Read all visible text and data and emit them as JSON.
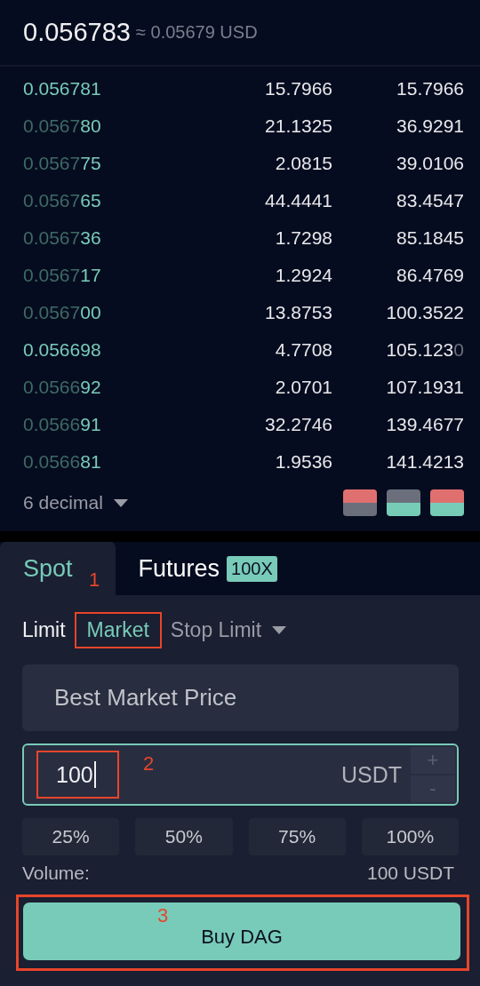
{
  "header": {
    "last_price": "0.056783",
    "approx": "≈ 0.05679 USD"
  },
  "order_book": {
    "rows": [
      {
        "price_dim": "",
        "price_hi": "0.056781",
        "amount": "15.7966",
        "total": "15.7966",
        "total_dim": ""
      },
      {
        "price_dim": "0.0567",
        "price_hi": "80",
        "amount": "21.1325",
        "total": "36.9291",
        "total_dim": ""
      },
      {
        "price_dim": "0.0567",
        "price_hi": "75",
        "amount": "2.0815",
        "total": "39.0106",
        "total_dim": ""
      },
      {
        "price_dim": "0.0567",
        "price_hi": "65",
        "amount": "44.4441",
        "total": "83.4547",
        "total_dim": ""
      },
      {
        "price_dim": "0.0567",
        "price_hi": "36",
        "amount": "1.7298",
        "total": "85.1845",
        "total_dim": ""
      },
      {
        "price_dim": "0.0567",
        "price_hi": "17",
        "amount": "1.2924",
        "total": "86.4769",
        "total_dim": ""
      },
      {
        "price_dim": "0.0567",
        "price_hi": "00",
        "amount": "13.8753",
        "total": "100.3522",
        "total_dim": ""
      },
      {
        "price_dim": "",
        "price_hi": "0.056698",
        "amount": "4.7708",
        "total": "105.123",
        "total_dim": "0"
      },
      {
        "price_dim": "0.0566",
        "price_hi": "92",
        "amount": "2.0701",
        "total": "107.1931",
        "total_dim": ""
      },
      {
        "price_dim": "0.0566",
        "price_hi": "91",
        "amount": "32.2746",
        "total": "139.4677",
        "total_dim": ""
      },
      {
        "price_dim": "0.0566",
        "price_hi": "81",
        "amount": "1.9536",
        "total": "141.4213",
        "total_dim": ""
      }
    ],
    "precision": "6 decimal",
    "layouts": [
      {
        "kind": "asks"
      },
      {
        "kind": "bids"
      },
      {
        "kind": "both"
      }
    ]
  },
  "tabs": [
    {
      "label": "Spot",
      "selected": true,
      "annotation": "1"
    },
    {
      "label": "Futures",
      "selected": false,
      "badge": "100X"
    }
  ],
  "order_types": [
    {
      "label": "Limit",
      "kind": "plain",
      "selected": false,
      "highlighted": false
    },
    {
      "label": "Market",
      "kind": "plain",
      "selected": true,
      "highlighted": true
    },
    {
      "label": "Stop Limit",
      "kind": "dropdown",
      "selected": false,
      "highlighted": false
    }
  ],
  "price_field": {
    "placeholder": "Best Market Price"
  },
  "amount_field": {
    "value": "100",
    "unit": "USDT",
    "highlighted": true,
    "annotation": "2",
    "increment": "+",
    "decrement": "-"
  },
  "percent_buttons": [
    "25%",
    "50%",
    "75%",
    "100%"
  ],
  "volume": {
    "label": "Volume:",
    "value": "100 USDT"
  },
  "buy_button": {
    "label": "Buy DAG",
    "highlighted": true,
    "annotation": "3"
  }
}
